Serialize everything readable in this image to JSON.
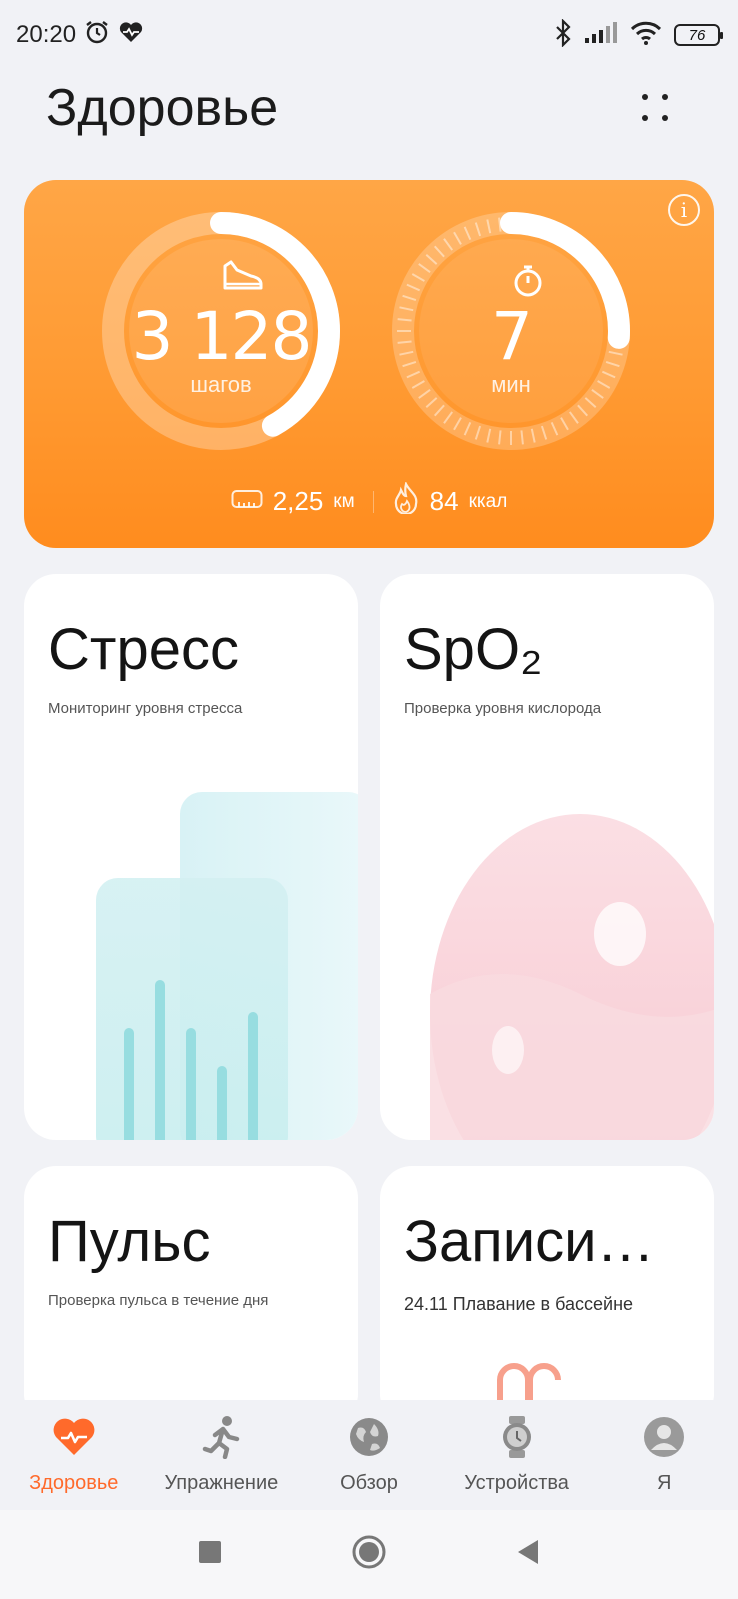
{
  "status": {
    "time": "20:20",
    "battery": "76"
  },
  "title": "Здоровье",
  "activity": {
    "steps_value": "3 128",
    "steps_unit": "шагов",
    "steps_progress": 0.42,
    "time_value": "7",
    "time_unit": "мин",
    "time_progress": 0.26,
    "distance_value": "2,25",
    "distance_unit": "км",
    "calories_value": "84",
    "calories_unit": "ккал"
  },
  "tiles": {
    "stress": {
      "title": "Стресс",
      "subtitle": "Мониторинг уровня стресса"
    },
    "spo2": {
      "title": "SpO₂",
      "subtitle": "Проверка уровня кислорода"
    },
    "pulse": {
      "title": "Пульс",
      "subtitle": "Проверка пульса в течение дня"
    },
    "records": {
      "title": "Записи…",
      "subtitle": "24.11  Плавание в бассейне"
    }
  },
  "nav": [
    {
      "label": "Здоровье",
      "icon": "heart-icon",
      "active": true
    },
    {
      "label": "Упражнение",
      "icon": "running-icon",
      "active": false
    },
    {
      "label": "Обзор",
      "icon": "globe-icon",
      "active": false
    },
    {
      "label": "Устройства",
      "icon": "watch-icon",
      "active": false
    },
    {
      "label": "Я",
      "icon": "profile-icon",
      "active": false
    }
  ],
  "colors": {
    "accent": "#ff6a2b",
    "card_orange": "#ff9a32"
  }
}
